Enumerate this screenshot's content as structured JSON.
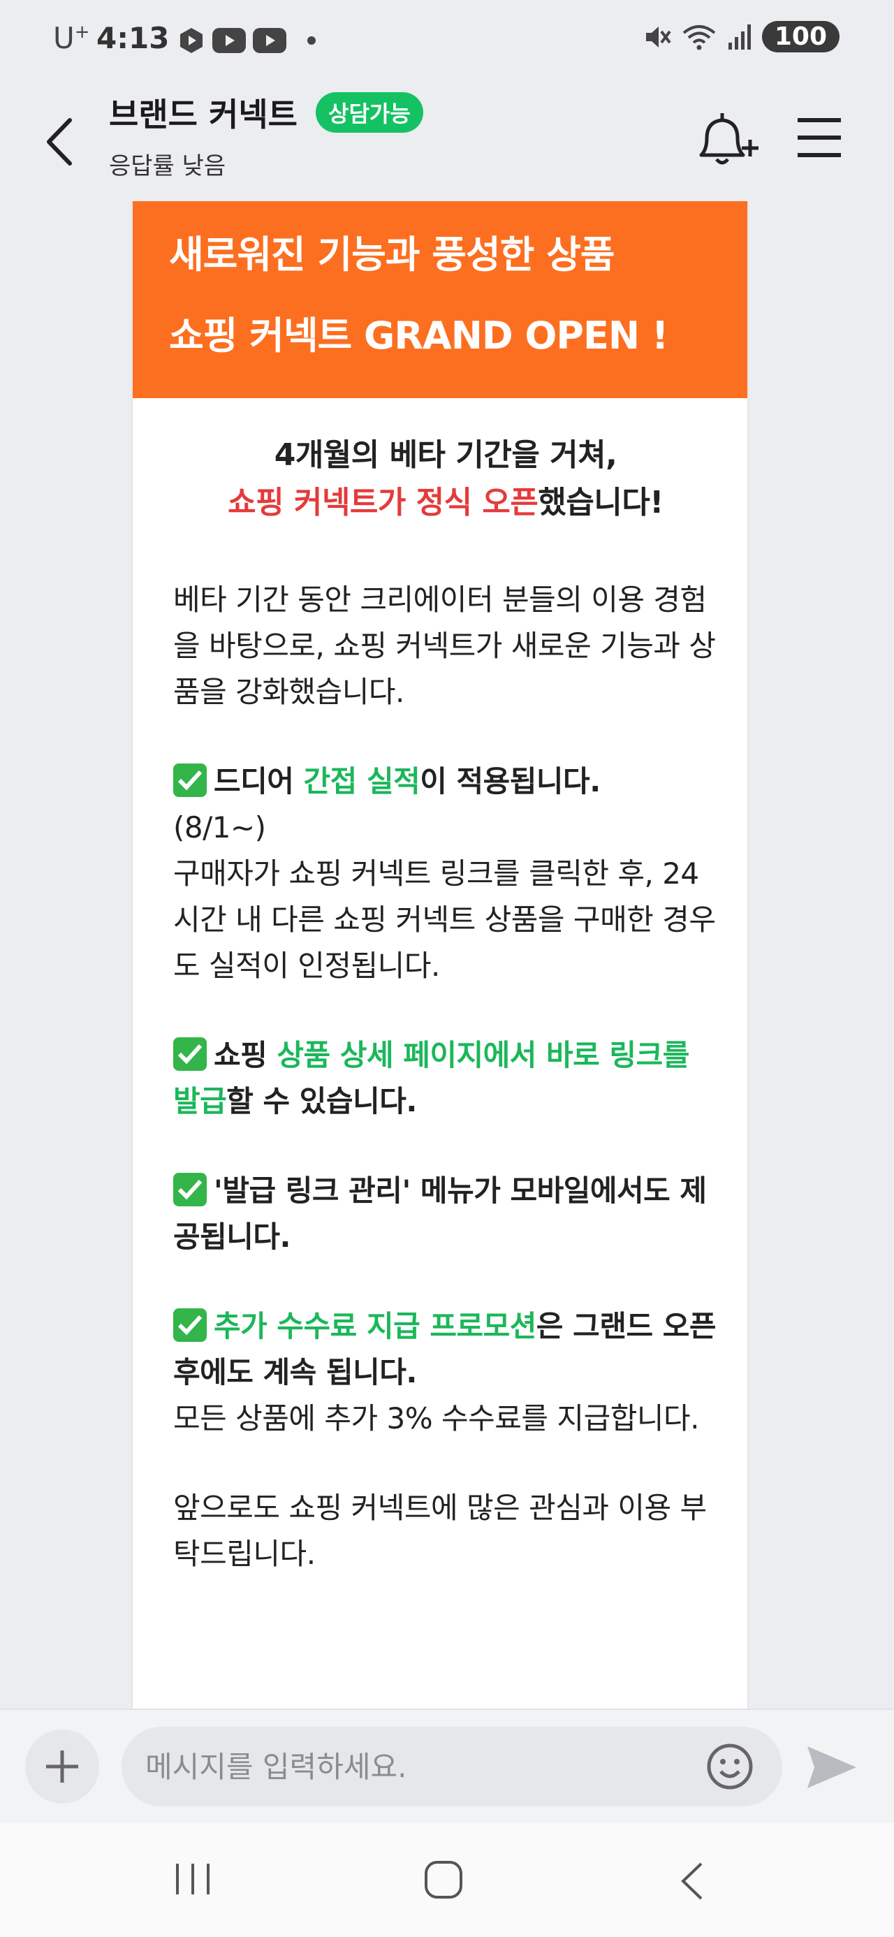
{
  "status_bar": {
    "carrier": "U",
    "carrier_sup": "+",
    "time": "4:13",
    "battery": "100",
    "icons": [
      "play-app-icon",
      "youtube-icon",
      "youtube-icon",
      "notification-dot",
      "mute-icon",
      "wifi-icon",
      "signal-icon",
      "battery-icon"
    ]
  },
  "header": {
    "title": "브랜드 커넥트",
    "badge": "상담가능",
    "subtitle": "응답률 낮음",
    "icons": [
      "back-icon",
      "bell-plus-icon",
      "menu-icon"
    ]
  },
  "message": {
    "banner_line1": "새로워진 기능과 풍성한 상품",
    "banner_line2": "쇼핑 커넥트 GRAND OPEN !",
    "intro_line1": "4개월의 베타 기간을 거쳐,",
    "intro_line2_red": "쇼핑 커넥트가 정식 오픈",
    "intro_line2_rest": "했습니다!",
    "para1": "베타 기간 동안 크리에이터 분들의 이용 경험을 바탕으로, 쇼핑 커넥트가 새로운 기능과 상품을 강화했습니다.",
    "item1_pre": "드디어 ",
    "item1_green": "간접 실적",
    "item1_post": "이 적용됩니다.",
    "item1_date": "(8/1~)",
    "item1_desc": "구매자가 쇼핑 커넥트 링크를 클릭한 후, 24시간 내 다른 쇼핑 커넥트 상품을 구매한 경우도 실적이 인정됩니다.",
    "item2_pre": "쇼핑 ",
    "item2_green": "상품 상세 페이지에서 바로 링크를 발급",
    "item2_post": "할 수 있습니다.",
    "item3": "'발급 링크 관리' 메뉴가 모바일에서도 제공됩니다.",
    "item4_green": "추가 수수료 지급 프로모션",
    "item4_post": "은 그랜드 오픈 후에도 계속 됩니다.",
    "item4_desc": "모든 상품에 추가 3% 수수료를 지급합니다.",
    "closing": "앞으로도 쇼핑 커넥트에 많은 관심과 이용 부탁드립니다.",
    "banner_color": "#fd6f20",
    "accent_green": "#1bb75a",
    "accent_red": "#e53a3a"
  },
  "input_bar": {
    "placeholder": "메시지를 입력하세요.",
    "icons": [
      "plus-icon",
      "emoji-icon",
      "send-icon"
    ]
  },
  "nav_bar": {
    "icons": [
      "recent-apps-icon",
      "home-icon",
      "back-nav-icon"
    ]
  }
}
